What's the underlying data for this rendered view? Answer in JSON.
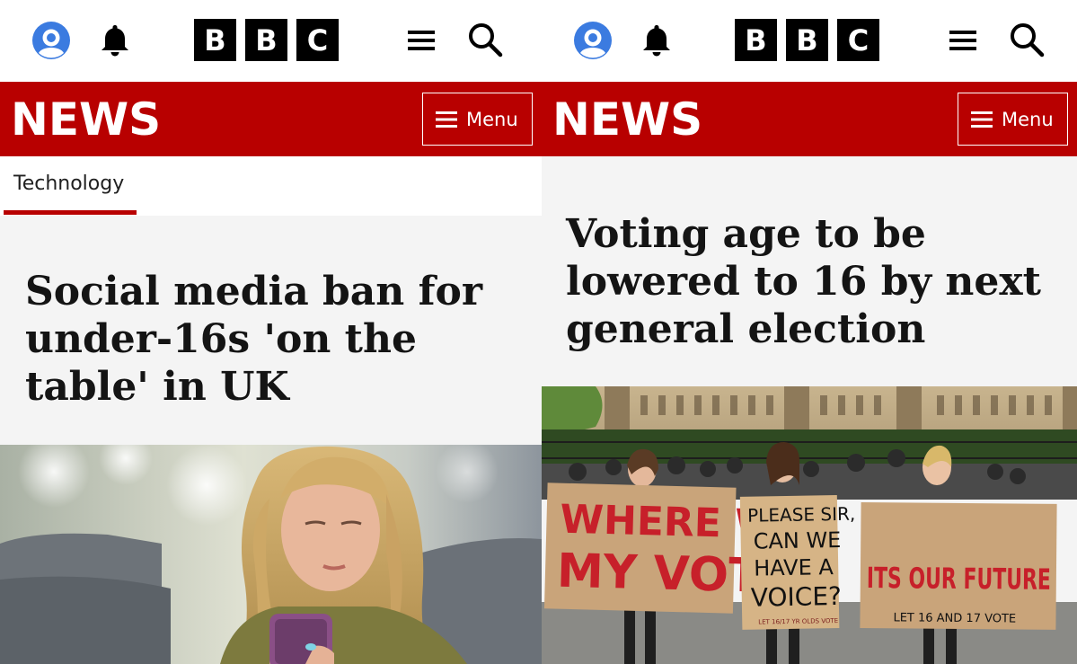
{
  "left": {
    "brand": {
      "b1": "B",
      "b2": "B",
      "b3": "C"
    },
    "news_label": "NEWS",
    "menu_label": "Menu",
    "section_tab": "Technology",
    "headline": "Social media ban for under-16s 'on the table' in UK",
    "image": "teen-girl-looking-at-phone"
  },
  "right": {
    "brand": {
      "b1": "B",
      "b2": "B",
      "b3": "C"
    },
    "news_label": "NEWS",
    "menu_label": "Menu",
    "headline": "Voting age to be lowered to 16 by next general election",
    "image": "young-protesters-with-signs",
    "signs": {
      "sign1_line1": "WHERE WAS",
      "sign1_line2": "MY VOTE",
      "sign2_line1": "PLEASE SIR,",
      "sign2_line2": "CAN WE",
      "sign2_line3": "HAVE A",
      "sign2_line4": "VOICE?",
      "sign2_small": "LET 16/17 YR OLDS VOTE",
      "sign3_big": "ITS OUR FUTURE",
      "sign3_small": "LET 16 AND 17 VOTE"
    }
  },
  "colors": {
    "bbc_red": "#b80000",
    "account_blue": "#3b7be0",
    "page_grey": "#f4f4f4"
  },
  "icons": [
    "account-icon",
    "bell-icon",
    "hamburger-icon",
    "search-icon"
  ]
}
